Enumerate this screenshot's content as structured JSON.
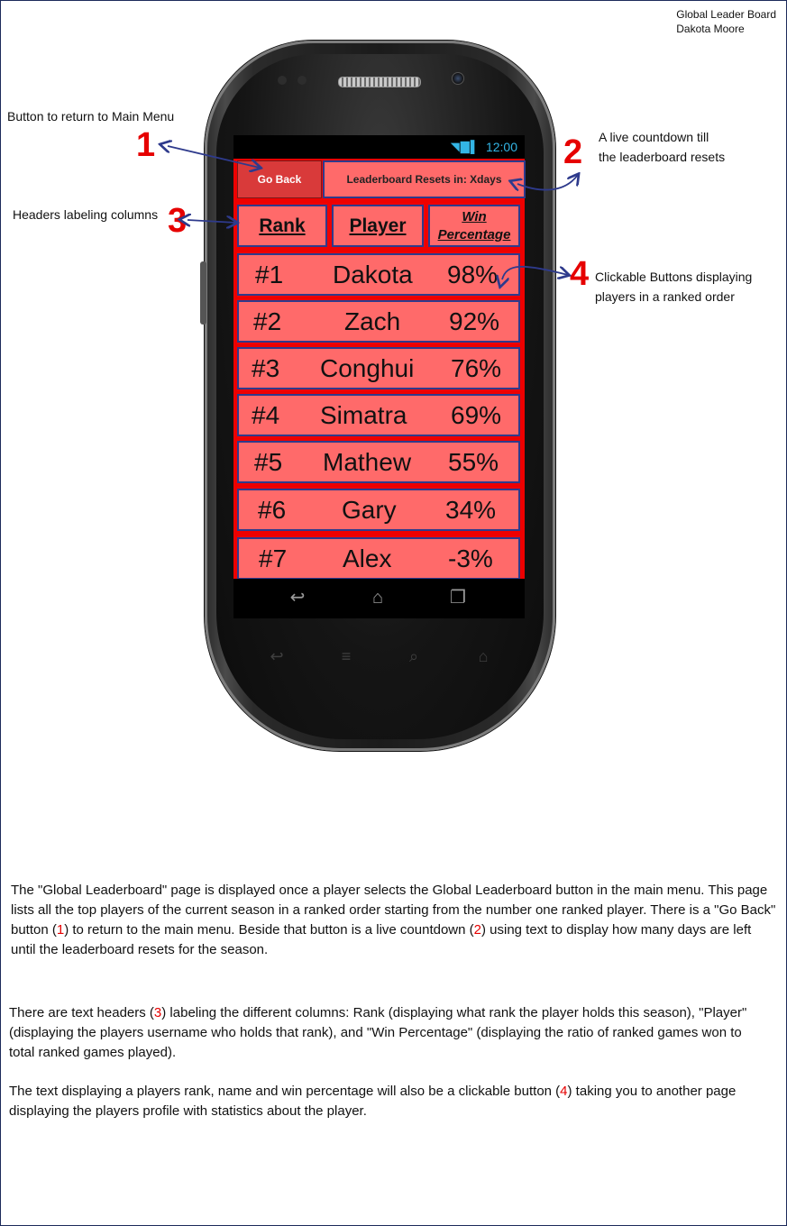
{
  "corner": {
    "line1": "Global Leader Board",
    "line2": "Dakota Moore"
  },
  "status_bar": {
    "time": "12:00"
  },
  "app": {
    "go_back_label": "Go Back",
    "countdown_label": "Leaderboard Resets in: Xdays",
    "headers": {
      "rank": "Rank",
      "player": "Player",
      "win_line1": "Win",
      "win_line2": "Percentage"
    },
    "rows": [
      {
        "rank": "#1",
        "player": "Dakota",
        "win": "98%"
      },
      {
        "rank": "#2",
        "player": "Zach",
        "win": "92%"
      },
      {
        "rank": "#3",
        "player": "Conghui",
        "win": "76%"
      },
      {
        "rank": "#4",
        "player": "Simatra",
        "win": "69%"
      },
      {
        "rank": "#5",
        "player": "Mathew",
        "win": "55%"
      },
      {
        "rank": "#6",
        "player": "Gary",
        "win": "34%"
      },
      {
        "rank": "#7",
        "player": "Alex",
        "win": "-3%"
      }
    ]
  },
  "annotations": {
    "a1": {
      "num": "1",
      "text": "Button to return to Main Menu"
    },
    "a2": {
      "num": "2",
      "line1": "A live countdown till",
      "line2": "the leaderboard resets"
    },
    "a3": {
      "num": "3",
      "text": "Headers labeling columns"
    },
    "a4": {
      "num": "4",
      "line1": "Clickable Buttons displaying",
      "line2": "players in a ranked order"
    }
  },
  "description": {
    "p1_a": "The \"Global Leaderboard\" page is displayed once a player selects the Global Leaderboard button in the main menu. This page lists all the top players of the current season in a ranked order starting from the number one ranked player. There is a \"Go Back\" button (",
    "p1_n1": "1",
    "p1_b": ") to return to the main menu. Beside that button is a live countdown (",
    "p1_n2": "2",
    "p1_c": ") using text to display how many days are left until the leaderboard resets for the season.",
    "p2_a": "There are text headers (",
    "p2_n": "3",
    "p2_b": ") labeling the different columns: Rank (displaying what rank the player holds this season), \"Player\" (displaying the players username who holds that rank), and \"Win Percentage\" (displaying the ratio of ranked games won to total ranked games played).",
    "p3_a": "The text displaying a players rank, name and win percentage will also be a clickable button (",
    "p3_n": "4",
    "p3_b": ") taking you to another page displaying the players profile with statistics about the player."
  },
  "colors": {
    "accent_red": "#e60000",
    "button_fill": "#ff6a6a",
    "border_blue": "#2e3a8c",
    "status_blue": "#33b5e5"
  }
}
